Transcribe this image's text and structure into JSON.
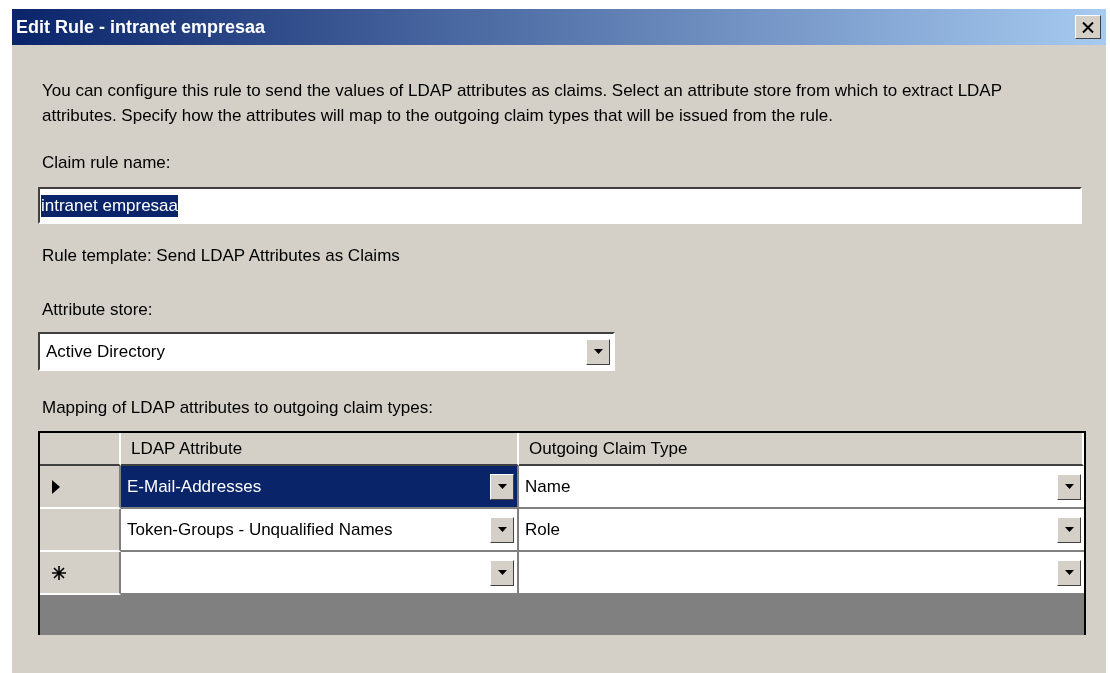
{
  "window": {
    "title": "Edit Rule - intranet empresaa"
  },
  "description": "You can configure this rule to send the values of LDAP attributes as claims. Select an attribute store from which to extract LDAP attributes. Specify how the attributes will map to the outgoing claim types that will be issued from the rule.",
  "claim_rule_name": {
    "label": "Claim rule name:",
    "value": "intranet empresaa",
    "text_selected": true
  },
  "rule_template": "Rule template: Send LDAP Attributes as Claims",
  "attribute_store": {
    "label": "Attribute store:",
    "value": "Active Directory"
  },
  "mapping": {
    "label": "Mapping of LDAP attributes to outgoing claim types:",
    "columns": [
      "LDAP Attribute",
      "Outgoing Claim Type"
    ],
    "rows": [
      {
        "kind": "current",
        "selected": true,
        "ldap_attribute": "E-Mail-Addresses",
        "claim_type": "Name"
      },
      {
        "kind": "plain",
        "selected": false,
        "ldap_attribute": "Token-Groups - Unqualified Names",
        "claim_type": "Role"
      },
      {
        "kind": "new",
        "selected": false
      }
    ]
  }
}
